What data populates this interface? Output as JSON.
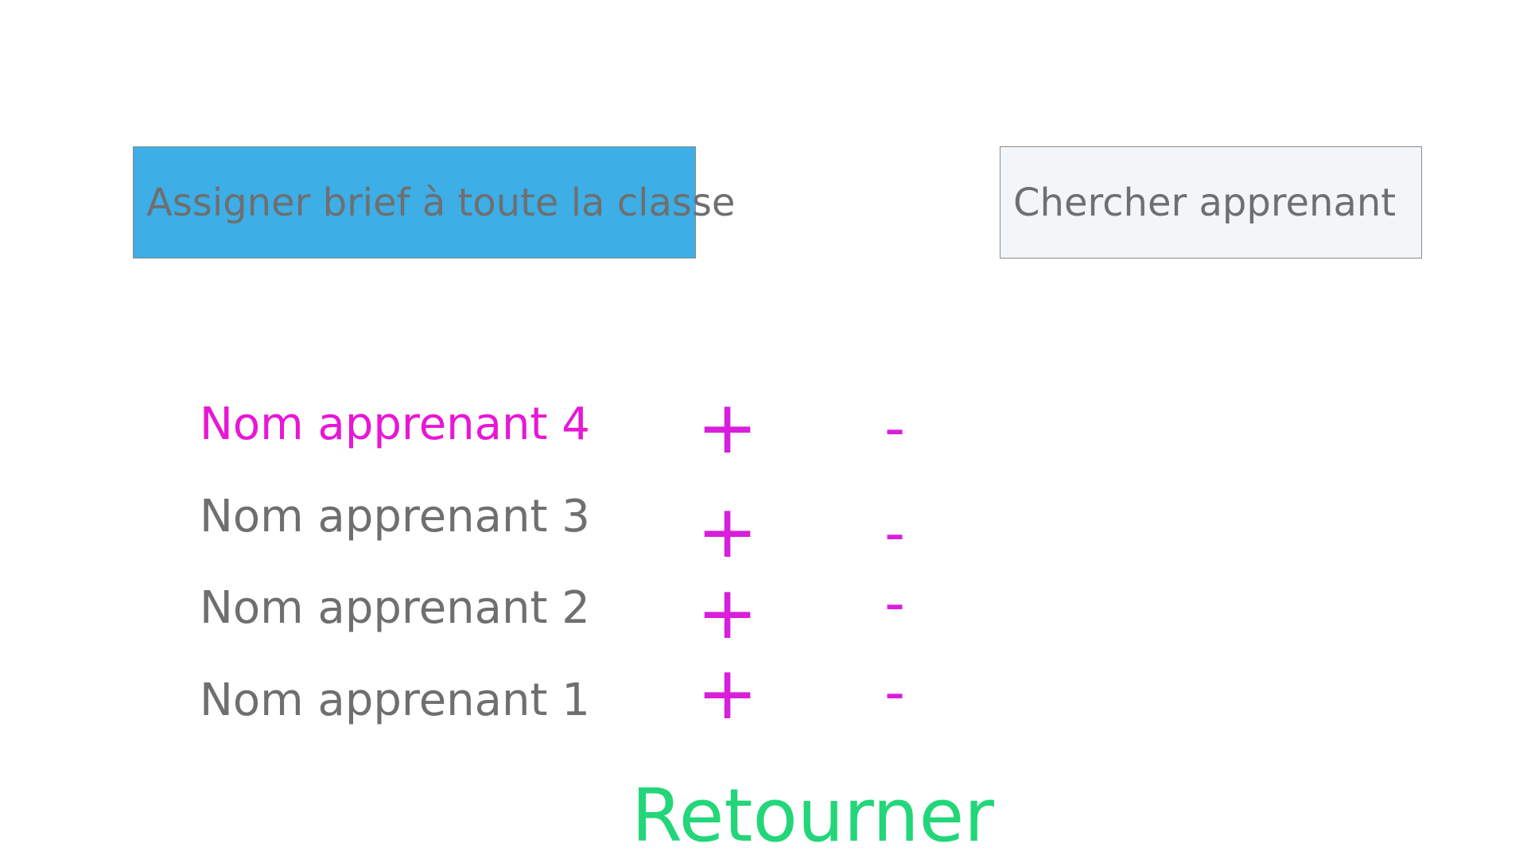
{
  "actions": {
    "assign_all_label": "Assigner brief à toute la classe",
    "search_label": "Chercher apprenant"
  },
  "learners": [
    {
      "name": "Nom apprenant 4",
      "add": "+",
      "remove": "-"
    },
    {
      "name": "Nom apprenant 3",
      "add": "+",
      "remove": "-"
    },
    {
      "name": "Nom apprenant 2",
      "add": "+",
      "remove": "-"
    },
    {
      "name": "Nom apprenant 1",
      "add": "+",
      "remove": "-"
    }
  ],
  "back_label": "Retourner",
  "colors": {
    "primary_button": "#3daee6",
    "secondary_button": "#f3f6f9",
    "text_gray": "#6f6f6f",
    "highlight_magenta": "#e817d6",
    "control_magenta": "#d91fdb",
    "back_green": "#22d679"
  }
}
